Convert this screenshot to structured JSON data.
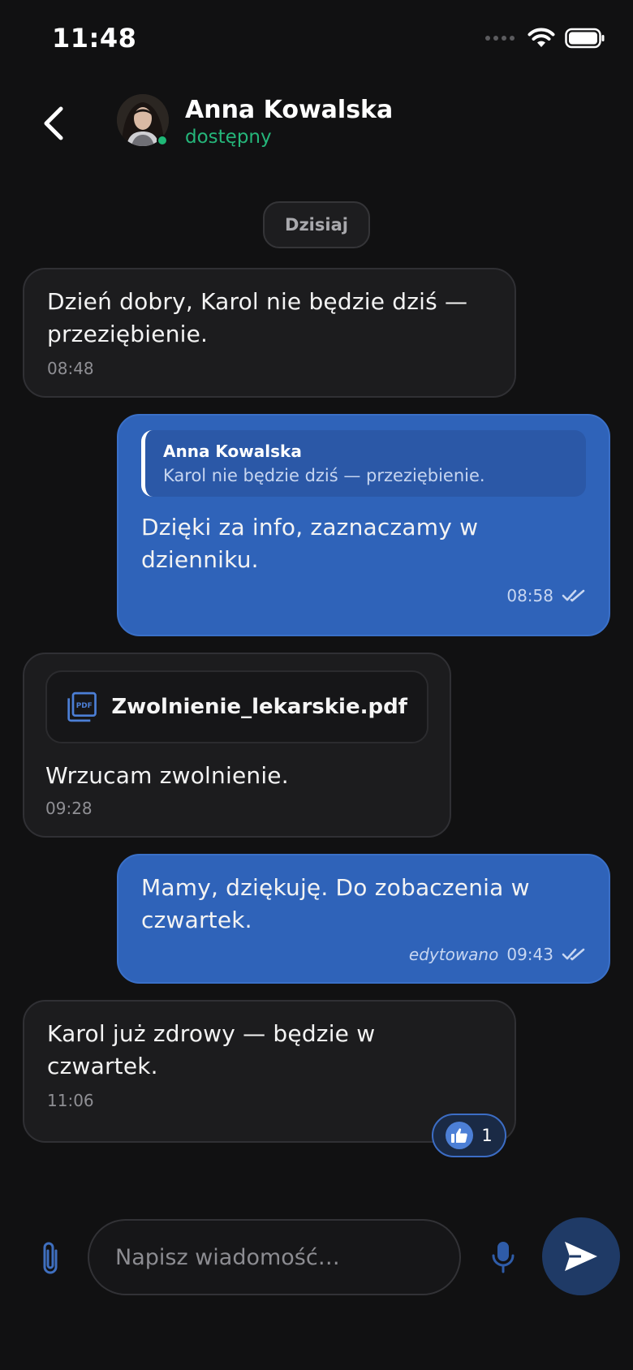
{
  "status_bar": {
    "time": "11:48"
  },
  "header": {
    "back_icon": "chevron-left-icon",
    "contact_name": "Anna Kowalska",
    "contact_status": "dostępny",
    "status_color": "#25b67a"
  },
  "date_separator": "Dzisiaj",
  "messages": [
    {
      "direction": "incoming",
      "text": "Dzień dobry, Karol nie będzie dziś — przeziębienie.",
      "time": "08:48"
    },
    {
      "direction": "outgoing",
      "quote": {
        "author": "Anna Kowalska",
        "text": "Karol nie będzie dziś — przeziębienie."
      },
      "text": "Dzięki za info, zaznaczamy w dzienniku.",
      "time": "08:58",
      "receipt": "double-check-icon"
    },
    {
      "direction": "incoming",
      "attachment": {
        "icon": "pdf-file-icon",
        "name": "Zwolnienie_lekarskie.pdf"
      },
      "text": "Wrzucam zwolnienie.",
      "time": "09:28"
    },
    {
      "direction": "outgoing",
      "text": "Mamy, dziękuję. Do zobaczenia w czwartek.",
      "edited_label": "edytowano",
      "time": "09:43",
      "receipt": "double-check-icon"
    },
    {
      "direction": "incoming",
      "text": "Karol już zdrowy — będzie w czwartek.",
      "time": "11:06",
      "reaction": {
        "icon": "thumbs-up-icon",
        "count": "1"
      }
    }
  ],
  "composer": {
    "placeholder": "Napisz wiadomość…",
    "attach_icon": "paperclip-icon",
    "mic_icon": "microphone-icon",
    "send_icon": "send-icon"
  },
  "colors": {
    "background": "#111112",
    "incoming_bubble": "#1c1c1e",
    "outgoing_bubble": "#2f63b9",
    "accent": "#4c7fd6"
  }
}
